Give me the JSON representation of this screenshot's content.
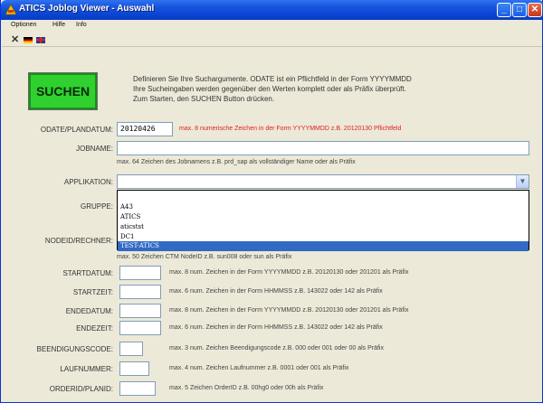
{
  "window": {
    "title": "ATICS Joblog Viewer - Auswahl",
    "controls": {
      "minimize": "_",
      "maximize": "□",
      "close": "✕"
    }
  },
  "menu": [
    "Optionen",
    "Hilfe",
    "Info"
  ],
  "toolbar": {
    "tools": [
      "close-x-icon",
      "german-flag-icon",
      "uk-flag-icon"
    ],
    "close_glyph": "✕"
  },
  "search_button": {
    "label": "SUCHEN",
    "color": "#2fd12f"
  },
  "description": [
    "Definieren Sie Ihre Suchargumente. ODATE ist ein Pflichtfeld in der Form YYYYMMDD",
    "Ihre Sucheingaben werden gegenüber den Werten komplett oder als Präfix überprüft.",
    "Zum Starten, den SUCHEN Button drücken."
  ],
  "fields": {
    "odate": {
      "label": "ODATE/PLANDATUM:",
      "value": "20120426",
      "hint": "max. 8 numerische Zeichen in der Form YYYYMMDD z.B. 20120130 Pflichtfeld"
    },
    "jobname": {
      "label": "JOBNAME:",
      "value": "",
      "hint": "max. 64 Zeichen des Jobnamens z.B. prd_sap als vollständiger Name oder als Präfix"
    },
    "applikation": {
      "label": "APPLIKATION:",
      "value": "",
      "options": [
        "",
        "A43",
        "ATICS",
        "aticstst",
        "DC1",
        "TEST-ATICS"
      ],
      "selected_index": 5
    },
    "gruppe": {
      "label": "GRUPPE:"
    },
    "nodeid": {
      "label": "NODEID/RECHNER:",
      "hint": "max. 50 Zeichen CTM NodeID z.B. sun008 oder sun als Präfix"
    },
    "startdatum": {
      "label": "STARTDATUM:",
      "value": "",
      "hint": "max. 8 num. Zeichen in der Form YYYYMMDD z.B. 20120130 oder 201201 als Präfix"
    },
    "startzeit": {
      "label": "STARTZEIT:",
      "value": "",
      "hint": "max. 6 num. Zeichen in der Form HHMMSS z.B. 143022 oder 142 als Präfix"
    },
    "endedatum": {
      "label": "ENDEDATUM:",
      "value": "",
      "hint": "max. 8 num. Zeichen in der Form YYYYMMDD z.B. 20120130 oder 201201 als Präfix"
    },
    "endezeit": {
      "label": "ENDEZEIT:",
      "value": "",
      "hint": "max. 6 num. Zeichen in der Form HHMMSS z.B. 143022 oder 142 als Präfix"
    },
    "beendigungscode": {
      "label": "BEENDIGUNGSCODE:",
      "value": "",
      "hint": "max. 3 num. Zeichen Beendigungscode z.B. 000 oder 001 oder 00 als Präfix"
    },
    "laufnummer": {
      "label": "LAUFNUMMER:",
      "value": "",
      "hint": "max. 4 num. Zeichen Laufnummer z.B. 0001 oder 001 als Präfix"
    },
    "orderid": {
      "label": "ORDERID/PLANID:",
      "value": "",
      "hint": "max. 5 Zeichen OrderID z.B. 00hg0 oder 00h als Präfix"
    }
  },
  "colors": {
    "title_bar": "#0a46d4",
    "hint_required": "#e02020",
    "selection": "#316ac5"
  }
}
